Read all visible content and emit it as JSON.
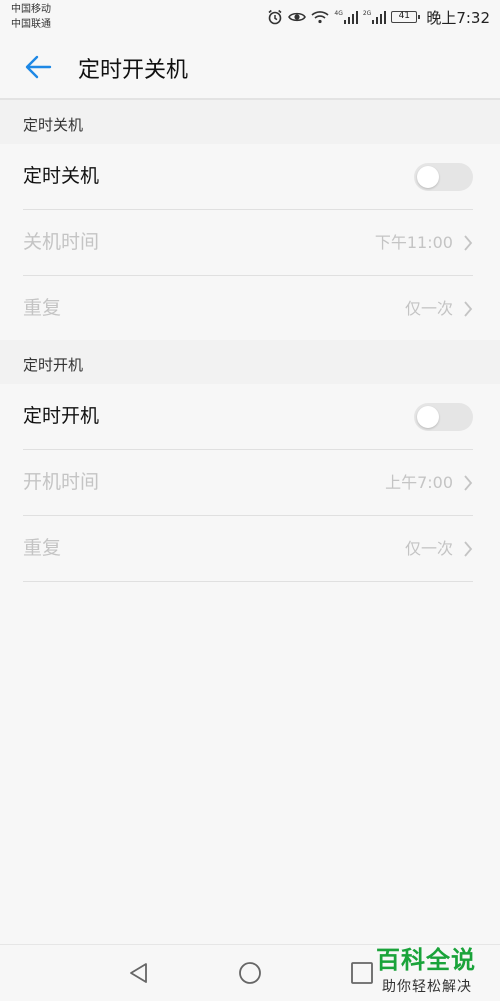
{
  "status_bar": {
    "carrier_1": "中国移动",
    "carrier_2": "中国联通",
    "signal_1_tag": "4G",
    "signal_2_tag": "2G",
    "battery": "41",
    "time": "晚上7:32"
  },
  "header": {
    "title": "定时开关机",
    "accent_color": "#1e88e5"
  },
  "shutdown": {
    "section_title": "定时关机",
    "toggle_label": "定时关机",
    "toggle_on": false,
    "time_label": "关机时间",
    "time_value": "下午11:00",
    "repeat_label": "重复",
    "repeat_value": "仅一次"
  },
  "startup": {
    "section_title": "定时开机",
    "toggle_label": "定时开机",
    "toggle_on": false,
    "time_label": "开机时间",
    "time_value": "上午7:00",
    "repeat_label": "重复",
    "repeat_value": "仅一次"
  },
  "nav": {
    "back": "back-triangle-icon",
    "home": "home-circle-icon",
    "recents": "recents-square-icon"
  },
  "watermark": {
    "title": "百科全说",
    "subtitle": "助你轻松解决"
  }
}
